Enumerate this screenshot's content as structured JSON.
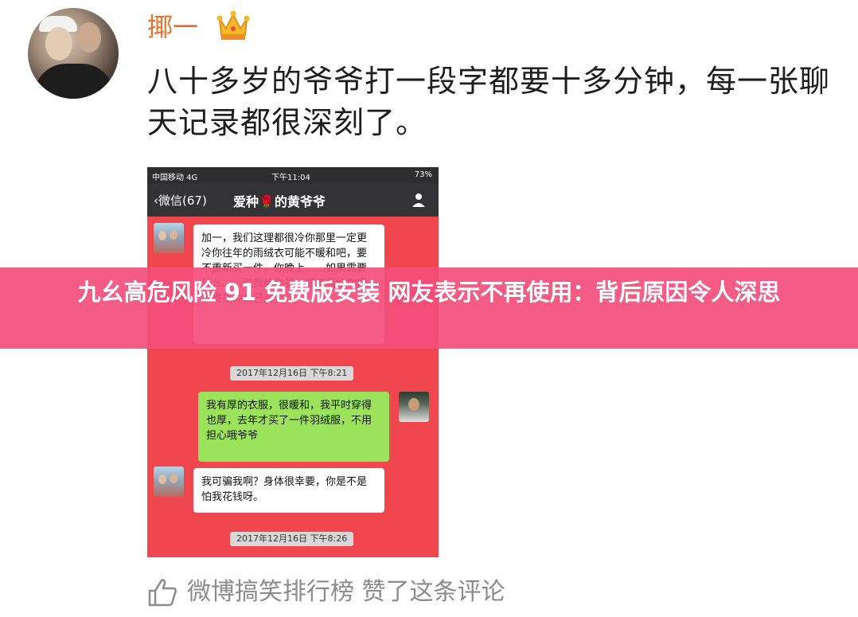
{
  "post": {
    "username": "揶一",
    "crown_icon": "crown-icon",
    "text": "八十多岁的爷爷打一段字都要十多分钟，每一张聊天记录都很深刻了。"
  },
  "phone": {
    "status_left": "中国移动 4G",
    "status_time": "下午11:04",
    "status_right": "73%",
    "back_label": "‹微信(67)",
    "chat_title": "爱种🌹的黄爷爷",
    "messages": [
      {
        "side": "left",
        "text": "加一，我们这理都很冷你那里一定更冷你往年的雨绒衣可能不暖和吧，要不重新买一件。你晚上……如果需要什么……说我给你买，或者我给你把钱寄来你自己买也"
      },
      {
        "side": "right",
        "text": "我有厚的衣服，很暖和，我平时穿得也厚，去年才买了一件羽绒服，不用担心哦爷爷"
      },
      {
        "side": "left",
        "text": "我可骗我啊？身体很幸要，你是不是怕我花钱呀。"
      }
    ],
    "timestamps": [
      "2017年12月16日 下午8:21",
      "2017年12月16日 下午8:26"
    ]
  },
  "banner": {
    "text": "九幺高危风险 91 免费版安装 网友表示不再使用：背后原因令人深思"
  },
  "footer": {
    "thumb_icon": "thumbs-up-icon",
    "text": "微博搞笑排行榜 赞了这条评论"
  },
  "colors": {
    "username": "#e8702a",
    "chat_bg": "#f0474f",
    "banner": "#f34e7c",
    "bubble_green": "#9ae35a"
  }
}
